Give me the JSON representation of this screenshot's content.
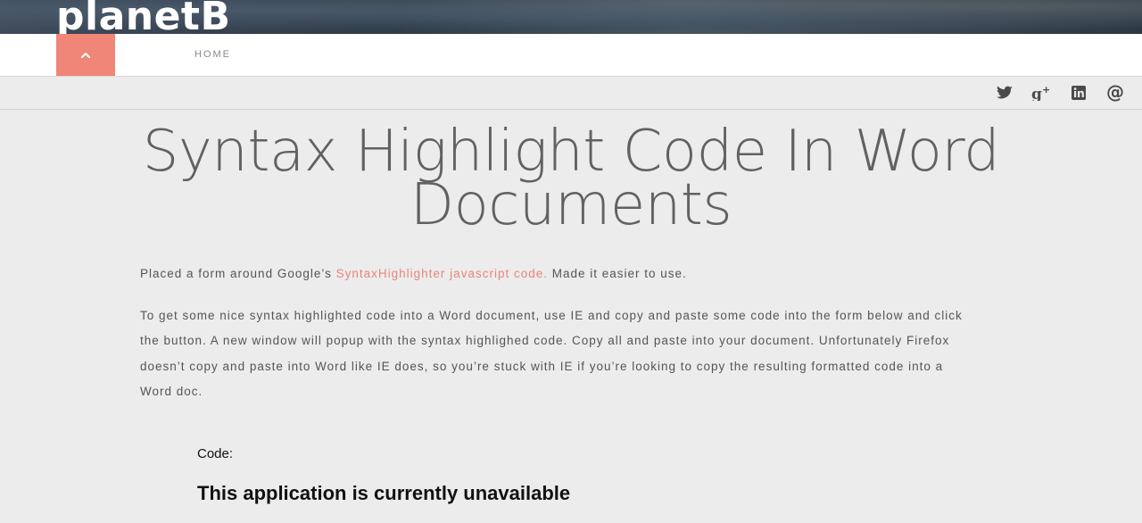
{
  "site": {
    "title": "planetB"
  },
  "nav": {
    "home_label": "HOME"
  },
  "social": {
    "icons": [
      "twitter-icon",
      "google-plus-icon",
      "linkedin-icon",
      "email-at-icon"
    ]
  },
  "article": {
    "title_line1": "Syntax Highlight Code In Word",
    "title_line2": "Documents",
    "intro_before": "Placed a form around Google’s ",
    "intro_link": "SyntaxHighlighter javascript code.",
    "intro_after": " Made it easier to use.",
    "body": "To get some nice syntax highlighted code into a Word document, use IE and copy and paste some code into the form below and click the button. A new window will popup with the syntax highlighed code. Copy all and paste into your document. Unfortunately Firefox doesn’t copy and paste into Word like IE does, so you’re stuck with IE if you’re looking to copy the resulting formatted code into a Word doc."
  },
  "form": {
    "code_label": "Code:",
    "unavailable_message": "This application is currently unavailable"
  },
  "colors": {
    "accent": "#f08677",
    "link": "#e8857a"
  }
}
